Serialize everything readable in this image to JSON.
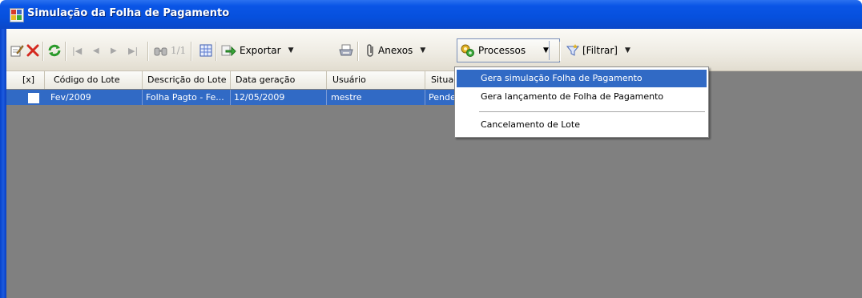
{
  "window": {
    "title": "Simulação da Folha de Pagamento"
  },
  "toolbar": {
    "page_indicator": "1/1",
    "exportar_label": "Exportar",
    "anexos_label": "Anexos",
    "processos_label": "Processos",
    "filtrar_label": "[Filtrar]",
    "icons": [
      "edit-icon",
      "delete-icon",
      "refresh-icon",
      "first-icon",
      "prev-icon",
      "next-icon",
      "last-icon",
      "find-icon",
      "grid-icon",
      "export-icon",
      "print-icon",
      "attachment-icon",
      "processes-icon",
      "filter-icon"
    ]
  },
  "grid": {
    "columns": [
      "[x]",
      "Código do Lote",
      "Descrição do Lote",
      "Data geração",
      "Usuário",
      "Situaç"
    ],
    "rows": [
      {
        "checked": false,
        "codigo": "Fev/2009",
        "descricao": "Folha Pagto - Fe...",
        "data": "12/05/2009",
        "usuario": "mestre",
        "situacao": "Pende"
      }
    ]
  },
  "menu": {
    "items": [
      "Gera simulação Folha de Pagamento",
      "Gera lançamento de Folha de Pagamento",
      "Cancelamento de Lote"
    ],
    "highlighted_index": 0
  },
  "colors": {
    "titlebar": "#0650dd",
    "selection": "#316ac5",
    "grid_background": "#808080",
    "toolbar": "#eeebe2"
  }
}
